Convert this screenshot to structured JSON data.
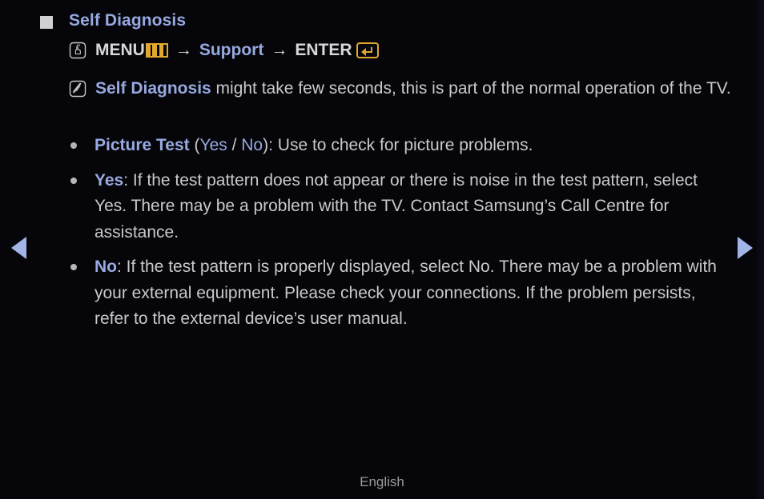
{
  "page": {
    "background_color": "#06060a",
    "text_color": "#c9c9cd",
    "accent_blue": "#97a9e0",
    "accent_gold": "#e0a82e"
  },
  "heading": {
    "bullet_icon": "filled-square-icon",
    "title": "Self Diagnosis"
  },
  "menu_path": {
    "lead_icon": "hand-press-button-icon",
    "menu_label": "MENU",
    "menu_icon": "menu-bars-icon",
    "arrow1": "→",
    "support_label": "Support",
    "arrow2": "→",
    "enter_label": "ENTER",
    "enter_icon": "enter-key-icon"
  },
  "note": {
    "icon": "note-pencil-icon",
    "strong": "Self Diagnosis",
    "rest": " might take few seconds, this is part of the normal operation of the TV."
  },
  "bullets": [
    {
      "name": "picture-test",
      "bullet_icon": "dot-bullet-icon",
      "parts": [
        {
          "text": "Picture Test",
          "style": "strong-blue"
        },
        {
          "text": " (",
          "style": "normal"
        },
        {
          "text": "Yes",
          "style": "blue"
        },
        {
          "text": " / ",
          "style": "normal"
        },
        {
          "text": "No",
          "style": "blue"
        },
        {
          "text": "): Use to check for picture problems.",
          "style": "normal"
        }
      ]
    },
    {
      "name": "yes-option",
      "bullet_icon": "dot-bullet-icon",
      "parts": [
        {
          "text": "Yes",
          "style": "strong-blue"
        },
        {
          "text": ": If the test pattern does not appear or there is noise in the test pattern, select Yes. There may be a problem with the TV. Contact Samsung’s Call Centre for assistance.",
          "style": "normal"
        }
      ]
    },
    {
      "name": "no-option",
      "bullet_icon": "dot-bullet-icon",
      "parts": [
        {
          "text": "No",
          "style": "strong-blue"
        },
        {
          "text": ": If the test pattern is properly displayed, select No. There may be a problem with your external equipment. Please check your connections. If the problem persists, refer to the external device’s user manual.",
          "style": "normal"
        }
      ]
    }
  ],
  "navigation": {
    "prev_icon": "triangle-left-icon",
    "next_icon": "triangle-right-icon",
    "prev_label": "◀",
    "next_label": "▶"
  },
  "footer": {
    "language": "English"
  }
}
